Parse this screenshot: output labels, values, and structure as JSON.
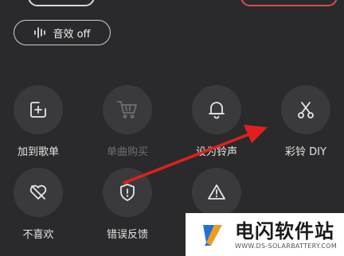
{
  "sound_effect": {
    "label": "音效 off",
    "icon": "sound-wave-icon"
  },
  "actions": [
    {
      "label": "加到歌单",
      "icon": "add-to-playlist-icon",
      "enabled": true
    },
    {
      "label": "单曲购买",
      "icon": "shopping-cart-icon",
      "enabled": false
    },
    {
      "label": "设为铃声",
      "icon": "bell-icon",
      "enabled": true
    },
    {
      "label": "彩铃 DIY",
      "icon": "scissors-icon",
      "enabled": true
    },
    {
      "label": "不喜欢",
      "icon": "broken-heart-icon",
      "enabled": true
    },
    {
      "label": "错误反馈",
      "icon": "error-shield-icon",
      "enabled": true
    },
    {
      "label": "",
      "icon": "warning-icon",
      "enabled": true
    }
  ],
  "watermark": {
    "title": "电闪软件站",
    "url": "WWW.DS-SOLARBATTERY.COM"
  },
  "colors": {
    "background": "#2a2a2c",
    "circle": "#3a3a3d",
    "arrow": "#e02020",
    "accent": "#d84b57"
  }
}
